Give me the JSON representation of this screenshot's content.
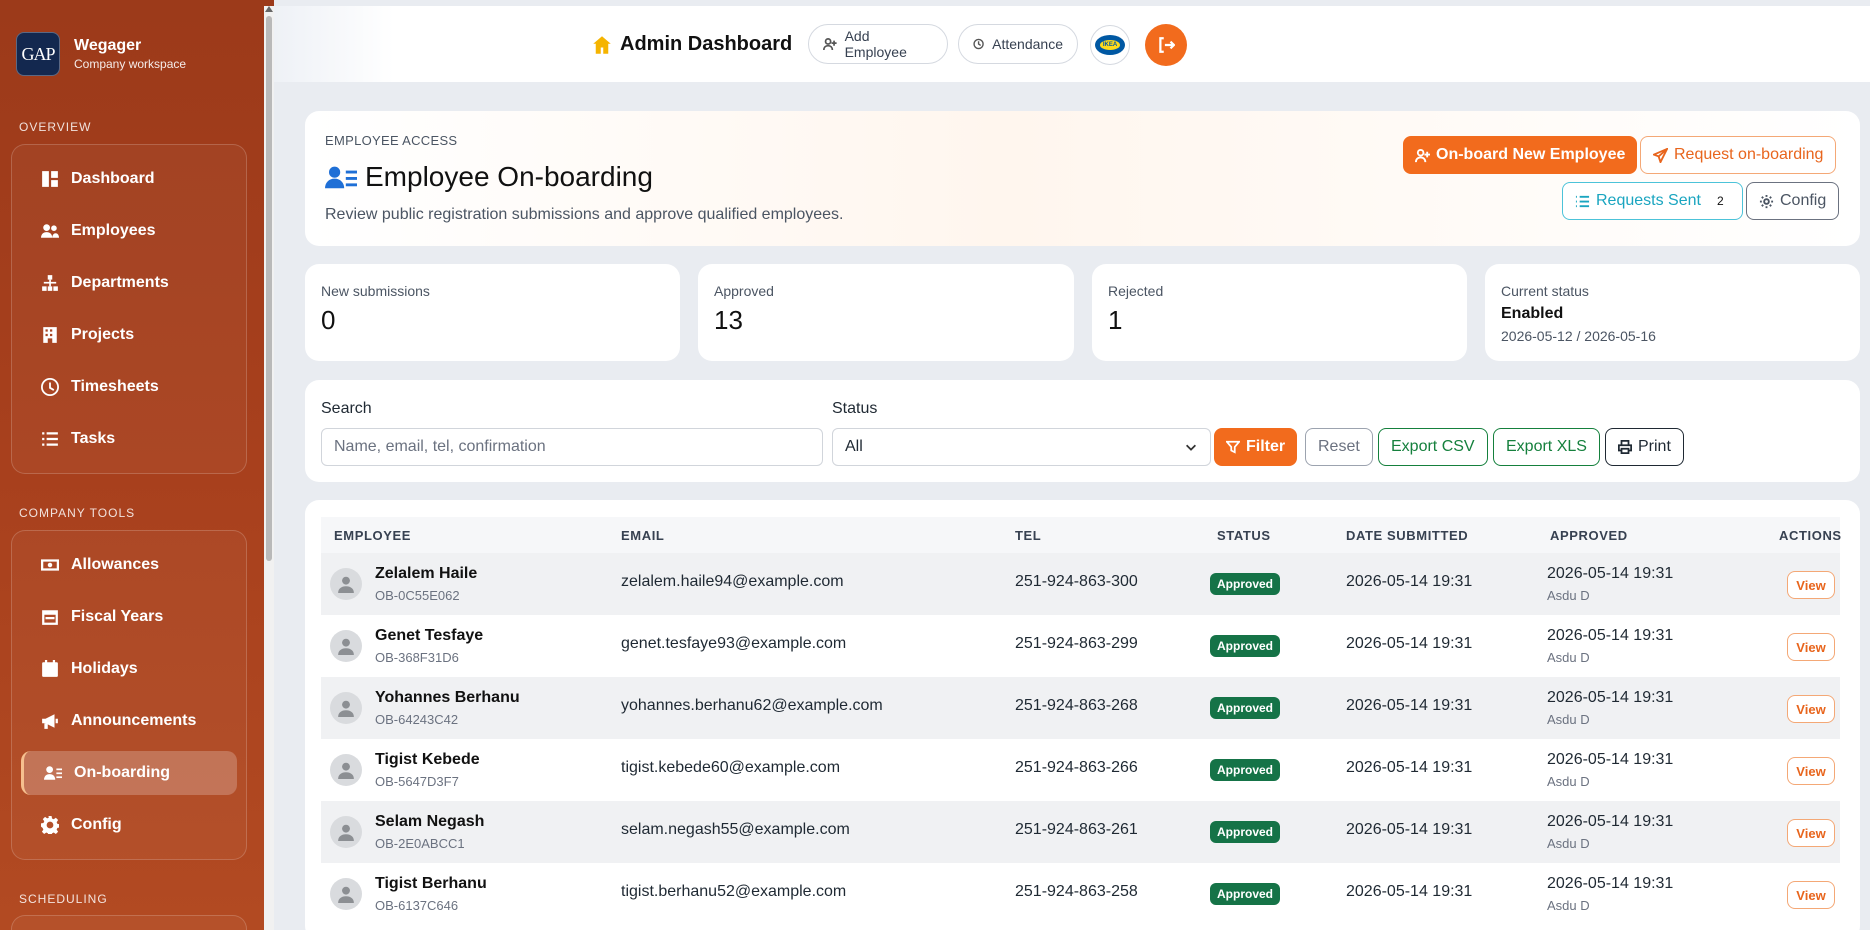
{
  "brand": {
    "logo_text": "GAP",
    "name": "Wegager",
    "subtitle": "Company workspace"
  },
  "sidebar": {
    "overview_title": "OVERVIEW",
    "overview_items": [
      {
        "label": "Dashboard",
        "icon": "dashboard-icon"
      },
      {
        "label": "Employees",
        "icon": "users-icon"
      },
      {
        "label": "Departments",
        "icon": "sitemap-icon"
      },
      {
        "label": "Projects",
        "icon": "building-icon"
      },
      {
        "label": "Timesheets",
        "icon": "clock-icon"
      },
      {
        "label": "Tasks",
        "icon": "list-icon"
      }
    ],
    "tools_title": "COMPANY TOOLS",
    "tools_items": [
      {
        "label": "Allowances",
        "icon": "money-icon"
      },
      {
        "label": "Fiscal Years",
        "icon": "calendar-icon"
      },
      {
        "label": "Holidays",
        "icon": "calendar-event-icon"
      },
      {
        "label": "Announcements",
        "icon": "megaphone-icon"
      },
      {
        "label": "On-boarding",
        "icon": "user-list-icon",
        "active": true
      },
      {
        "label": "Config",
        "icon": "gear-icon"
      }
    ],
    "scheduling_title": "SCHEDULING"
  },
  "topbar": {
    "title": "Admin Dashboard",
    "add_employee": "Add Employee",
    "attendance": "Attendance",
    "avatar_text": "IKEA"
  },
  "header": {
    "kicker": "EMPLOYEE ACCESS",
    "title": "Employee On-boarding",
    "description": "Review public registration submissions and approve qualified employees.",
    "onboard_btn": "On-board New Employee",
    "request_btn": "Request on-boarding",
    "requests_sent_btn": "Requests Sent",
    "requests_sent_count": "2",
    "config_btn": "Config"
  },
  "stats": {
    "new_label": "New submissions",
    "new_value": "0",
    "approved_label": "Approved",
    "approved_value": "13",
    "rejected_label": "Rejected",
    "rejected_value": "1",
    "status_label": "Current status",
    "status_value": "Enabled",
    "status_range": "2026-05-12 / 2026-05-16"
  },
  "filters": {
    "search_label": "Search",
    "search_placeholder": "Name, email, tel, confirmation",
    "status_label": "Status",
    "status_value": "All",
    "filter_btn": "Filter",
    "reset_btn": "Reset",
    "csv_btn": "Export CSV",
    "xls_btn": "Export XLS",
    "print_btn": "Print"
  },
  "table": {
    "headers": [
      "EMPLOYEE",
      "EMAIL",
      "TEL",
      "STATUS",
      "DATE SUBMITTED",
      "APPROVED",
      "ACTIONS"
    ],
    "rows": [
      {
        "name": "Zelalem Haile",
        "code": "OB-0C55E062",
        "email": "zelalem.haile94@example.com",
        "tel": "251-924-863-300",
        "status": "Approved",
        "submitted": "2026-05-14 19:31",
        "approved": "2026-05-14 19:31",
        "approved_by": "Asdu D",
        "action": "View"
      },
      {
        "name": "Genet Tesfaye",
        "code": "OB-368F31D6",
        "email": "genet.tesfaye93@example.com",
        "tel": "251-924-863-299",
        "status": "Approved",
        "submitted": "2026-05-14 19:31",
        "approved": "2026-05-14 19:31",
        "approved_by": "Asdu D",
        "action": "View"
      },
      {
        "name": "Yohannes Berhanu",
        "code": "OB-64243C42",
        "email": "yohannes.berhanu62@example.com",
        "tel": "251-924-863-268",
        "status": "Approved",
        "submitted": "2026-05-14 19:31",
        "approved": "2026-05-14 19:31",
        "approved_by": "Asdu D",
        "action": "View"
      },
      {
        "name": "Tigist Kebede",
        "code": "OB-5647D3F7",
        "email": "tigist.kebede60@example.com",
        "tel": "251-924-863-266",
        "status": "Approved",
        "submitted": "2026-05-14 19:31",
        "approved": "2026-05-14 19:31",
        "approved_by": "Asdu D",
        "action": "View"
      },
      {
        "name": "Selam Negash",
        "code": "OB-2E0ABCC1",
        "email": "selam.negash55@example.com",
        "tel": "251-924-863-261",
        "status": "Approved",
        "submitted": "2026-05-14 19:31",
        "approved": "2026-05-14 19:31",
        "approved_by": "Asdu D",
        "action": "View"
      },
      {
        "name": "Tigist Berhanu",
        "code": "OB-6137C646",
        "email": "tigist.berhanu52@example.com",
        "tel": "251-924-863-258",
        "status": "Approved",
        "submitted": "2026-05-14 19:31",
        "approved": "2026-05-14 19:31",
        "approved_by": "Asdu D",
        "action": "View"
      }
    ]
  },
  "colors": {
    "accent": "#f26b1d",
    "sidebar": "#a8401d",
    "success": "#157347",
    "info": "#1aa5c0"
  }
}
